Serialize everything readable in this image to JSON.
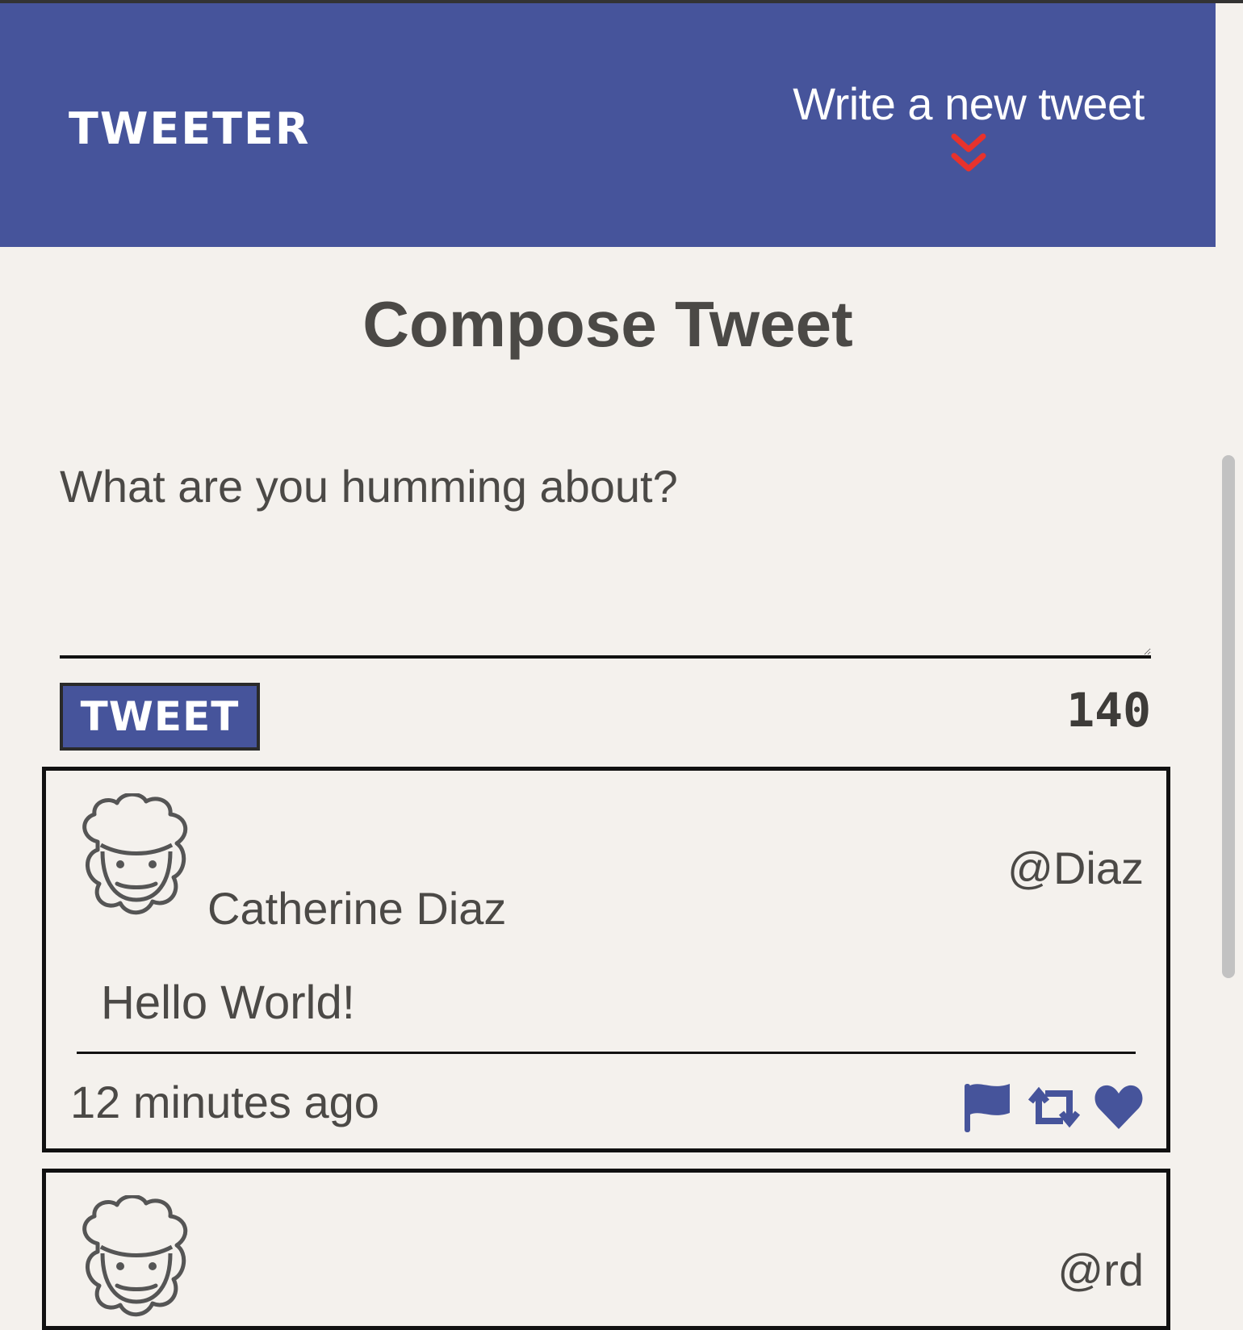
{
  "nav": {
    "brand": "TWEETER",
    "write_new_label": "Write a new tweet",
    "write_new_icon": "double-chevron-down-icon",
    "accent_color": "#e8322c",
    "background_color": "#46549b"
  },
  "compose": {
    "title": "Compose Tweet",
    "placeholder": "What are you humming about?",
    "value": "",
    "tweet_button_label": "TWEET",
    "char_counter": "140"
  },
  "tweets": [
    {
      "name": "Catherine Diaz",
      "handle": "@Diaz",
      "content": "Hello World!",
      "time": "12 minutes ago",
      "avatar_icon": "avatar-face-icon",
      "actions": [
        "flag-icon",
        "retweet-icon",
        "heart-icon"
      ]
    },
    {
      "name": "",
      "handle": "@rd",
      "avatar_icon": "avatar-face-icon"
    }
  ]
}
